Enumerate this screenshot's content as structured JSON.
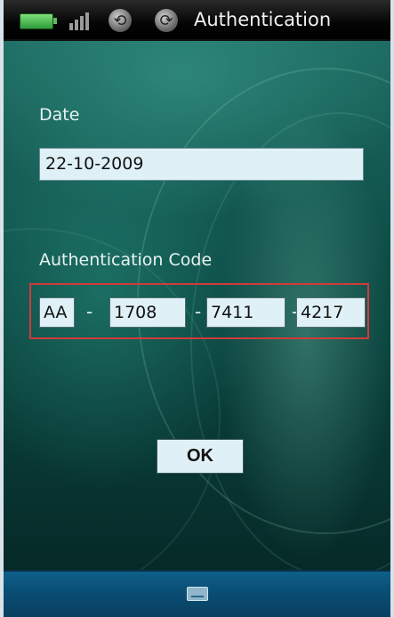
{
  "status_bar": {
    "title": "Authentication",
    "icons": [
      "battery-icon",
      "signal-icon",
      "sync-icon",
      "refresh-icon"
    ]
  },
  "form": {
    "date_label": "Date",
    "date_value": "22-10-2009",
    "code_label": "Authentication Code",
    "code_parts": [
      "AA",
      "1708",
      "7411",
      "4217"
    ],
    "separator": "-"
  },
  "actions": {
    "ok_label": "OK"
  },
  "bottom_bar": {
    "icon": "keyboard-icon"
  },
  "colors": {
    "highlight_border": "#d23a3a",
    "field_bg": "#dff1f7"
  }
}
